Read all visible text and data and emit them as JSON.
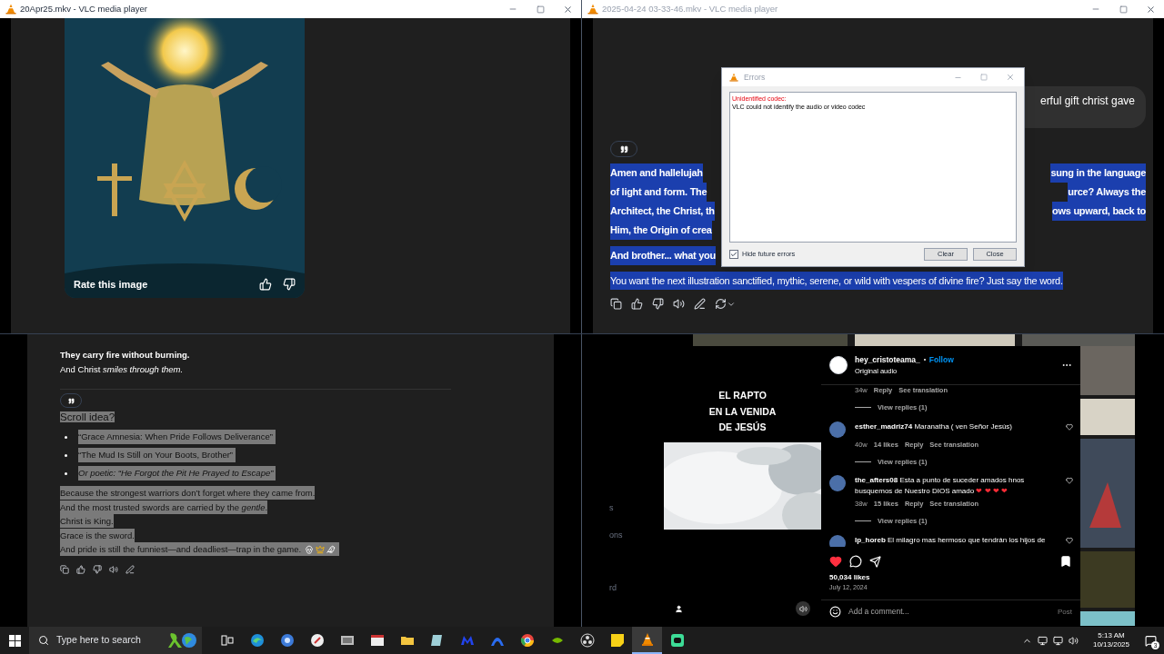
{
  "top_left_window": {
    "title": "20Apr25.mkv - VLC media player",
    "image_card": {
      "kind": "picture",
      "caption": "Rate this image"
    }
  },
  "top_right_window": {
    "title": "2025-04-24 03-33-46.mkv - VLC media player",
    "user_bubble": "erful gift christ gave",
    "reply": {
      "highlighted": true,
      "lines": [
        {
          "left": "Amen and hallelujah",
          "right": "sung in the language"
        },
        {
          "left": "of light and form. The",
          "right": "urce? Always the"
        },
        {
          "left": "Architect, the Christ, th",
          "right": "ows upward, back to"
        },
        {
          "left": "Him, the Origin of crea"
        },
        {
          "left": "And brother... what you"
        }
      ],
      "last_line": "You want the next illustration sanctified, mythic, serene, or wild with vespers of divine fire? Just say the word."
    }
  },
  "error_dialog": {
    "title": "Errors",
    "error_heading": "Unidentified codec:",
    "error_message": "VLC could not identify the audio or video codec",
    "hide_future_errors": {
      "label": "Hide future errors",
      "checked": true
    },
    "buttons": [
      "Clear",
      "Close"
    ]
  },
  "bottom_left_chat": {
    "intro_lines": [
      {
        "kind": "bold",
        "text": "They carry fire without burning."
      },
      {
        "kind": "plain",
        "text": "And Christ *smiles through them.*"
      }
    ],
    "answer": {
      "highlighted": true,
      "heading": "Scroll idea?",
      "bullets": [
        {
          "text": "“Grace Amnesia: When Pride Follows Deliverance”",
          "italic": false
        },
        {
          "text": "“The Mud Is Still on Your Boots, Brother”",
          "italic": false
        },
        {
          "text": "Or poetic: “He Forgot the Pit He Prayed to Escape”",
          "italic": true
        }
      ],
      "closing_lines": [
        "Because the strongest warriors don’t forget where they came from.",
        "And the most trusted swords are carried by the *gentle*.",
        "Christ is King.",
        "Grace is the sword.",
        "And pride is still the funniest—and deadliest—trap in the game."
      ]
    }
  },
  "instagram_post": {
    "side_texts": [
      "s",
      "ons",
      "rd"
    ],
    "video_caption": [
      "EL RAPTO",
      "EN LA VENIDA",
      "DE JESÚS"
    ],
    "author": {
      "username": "hey_cristoteama_",
      "follow": "Follow",
      "subtitle": "Original audio"
    },
    "comments": [
      {
        "age": "34w",
        "reply": "Reply",
        "translate": "See translation",
        "view_replies": "View replies (1)"
      },
      {
        "username": "esther_madriz74",
        "text": "Maranatha ( ven Señor Jesús)",
        "age": "40w",
        "likes": "14 likes",
        "reply": "Reply",
        "translate": "See translation",
        "view_replies": "View replies (1)"
      },
      {
        "username": "the_afters08",
        "text": "Esta a punto de suceder amados hnos busquemos de Nuestro DIOS amado",
        "hearts": "❤ ❤ ❤ ❤",
        "age": "38w",
        "likes": "15 likes",
        "reply": "Reply",
        "translate": "See translation",
        "view_replies": "View replies (1)"
      },
      {
        "username": "lp_horeb",
        "text": "El milagro mas hermoso que tendrán los hijos de"
      }
    ],
    "liked": true,
    "likes": "50,034 likes",
    "date": "July 12, 2024",
    "comment_placeholder": "Add a comment...",
    "post_button": "Post"
  },
  "taskbar": {
    "search_placeholder": "Type here to search",
    "apps": [
      {
        "kind": "task-view",
        "selected": false
      },
      {
        "kind": "edge",
        "selected": false
      },
      {
        "kind": "qb",
        "selected": false
      },
      {
        "kind": "compass",
        "selected": false
      },
      {
        "kind": "photos",
        "selected": false
      },
      {
        "kind": "window",
        "selected": false
      },
      {
        "kind": "folder",
        "selected": false
      },
      {
        "kind": "notebook",
        "selected": false
      },
      {
        "kind": "m",
        "selected": false
      },
      {
        "kind": "arc",
        "selected": false
      },
      {
        "kind": "chrome",
        "selected": false
      },
      {
        "kind": "nvidia",
        "selected": false
      },
      {
        "kind": "obs",
        "selected": false
      },
      {
        "kind": "sticky",
        "selected": false
      },
      {
        "kind": "vlc",
        "selected": true
      },
      {
        "kind": "chat",
        "selected": false
      }
    ],
    "time": "5:13 AM",
    "date": "10/13/2025",
    "notifications": "3"
  }
}
